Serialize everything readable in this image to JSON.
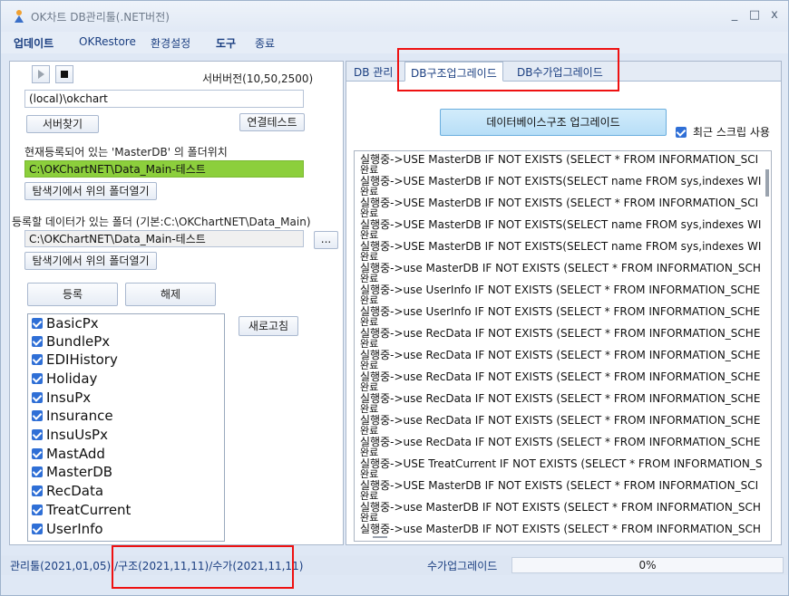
{
  "window": {
    "title": "OK차트 DB관리툴(.NET버전)",
    "controls": [
      "_",
      "□",
      "x"
    ]
  },
  "menu": {
    "items": [
      "업데이트",
      "OKRestore",
      "환경설정",
      "도구",
      "종료"
    ]
  },
  "left": {
    "server_version": "서버버전(10,50,2500)",
    "server_value": "(local)\\okchart",
    "find_server": "서버찾기",
    "connection_test": "연결테스트",
    "masterdb_label": "현재등록되어 있는 'MasterDB' 의 폴더위치",
    "masterdb_path": "C:\\OKChartNET\\Data_Main-테스트",
    "open_folder_1": "탐색기에서 위의 폴더열기",
    "data_folder_label": "등록할 데이터가 있는 폴더 (기본:C:\\OKChartNET\\Data_Main)",
    "data_folder_path": "C:\\OKChartNET\\Data_Main-테스트",
    "browse": "...",
    "open_folder_2": "탐색기에서 위의 폴더열기",
    "register": "등록",
    "unregister": "해제",
    "refresh": "새로고침",
    "databases": [
      "BasicPx",
      "BundlePx",
      "EDIHistory",
      "Holiday",
      "InsuPx",
      "Insurance",
      "InsuUsPx",
      "MastAdd",
      "MasterDB",
      "RecData",
      "TreatCurrent",
      "UserInfo"
    ]
  },
  "right": {
    "tabs": [
      "DB 관리",
      "DB구조업그레이드",
      "DB수가업그레이드"
    ],
    "active_tab": 1,
    "upgrade_button": "데이터베이스구조 업그레이드",
    "recent_script": "최근 스크립 사용",
    "log_lines": [
      "실행중->USE MasterDB IF NOT EXISTS (SELECT * FROM INFORMATION_SCI",
      "완료",
      "실행중->USE MasterDB IF NOT EXISTS(SELECT name FROM sys,indexes WI",
      "완료",
      "실행중->USE MasterDB IF NOT EXISTS (SELECT * FROM INFORMATION_SCI",
      "완료",
      "실행중->USE MasterDB IF NOT EXISTS(SELECT name FROM sys,indexes WI",
      "완료",
      "실행중->USE MasterDB IF NOT EXISTS(SELECT name FROM sys,indexes WI",
      "완료",
      "실행중->use MasterDB IF NOT EXISTS (SELECT * FROM INFORMATION_SCH",
      "완료",
      "실행중->use UserInfo IF NOT EXISTS (SELECT * FROM INFORMATION_SCHE",
      "완료",
      "실행중->use UserInfo IF NOT EXISTS (SELECT * FROM INFORMATION_SCHE",
      "완료",
      "실행중->use RecData IF NOT EXISTS (SELECT * FROM INFORMATION_SCHE",
      "완료",
      "실행중->use RecData IF NOT EXISTS (SELECT * FROM INFORMATION_SCHE",
      "완료",
      "실행중->use RecData IF NOT EXISTS (SELECT * FROM INFORMATION_SCHE",
      "완료",
      "실행중->use RecData IF NOT EXISTS (SELECT * FROM INFORMATION_SCHE",
      "완료",
      "실행중->use RecData IF NOT EXISTS (SELECT * FROM INFORMATION_SCHE",
      "완료",
      "실행중->use RecData IF NOT EXISTS (SELECT * FROM INFORMATION_SCHE",
      "완료",
      "실행중->USE TreatCurrent IF NOT EXISTS (SELECT * FROM INFORMATION_S",
      "완료",
      "실행중->USE MasterDB IF NOT EXISTS (SELECT * FROM INFORMATION_SCI",
      "완료",
      "실행중->use MasterDB IF NOT EXISTS (SELECT * FROM INFORMATION_SCH",
      "완료",
      "실행중->use MasterDB IF NOT EXISTS (SELECT * FROM INFORMATION_SCH"
    ]
  },
  "status": {
    "left_text": "관리툴(2021,01,05)",
    "middle_text": "/구조(2021,11,11)/수가(2021,11,11)",
    "upgrade_label": "수가업그레이드",
    "progress": "0%"
  },
  "colors": {
    "highlight": "#8ccf3c",
    "accent": "#2f6fd6",
    "annotation": "#ee1111"
  }
}
